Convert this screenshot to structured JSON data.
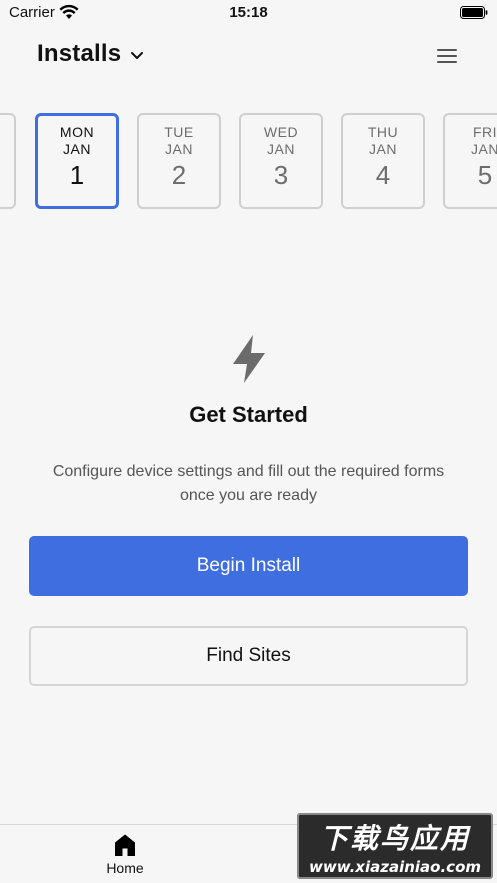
{
  "status_bar": {
    "carrier": "Carrier",
    "time": "15:18"
  },
  "header": {
    "title": "Installs"
  },
  "days": [
    {
      "dow": "",
      "month": "",
      "day": "",
      "selected": false
    },
    {
      "dow": "MON",
      "month": "JAN",
      "day": "1",
      "selected": true
    },
    {
      "dow": "TUE",
      "month": "JAN",
      "day": "2",
      "selected": false
    },
    {
      "dow": "WED",
      "month": "JAN",
      "day": "3",
      "selected": false
    },
    {
      "dow": "THU",
      "month": "JAN",
      "day": "4",
      "selected": false
    },
    {
      "dow": "FRI",
      "month": "JAN",
      "day": "5",
      "selected": false
    }
  ],
  "main": {
    "icon": "lightning-bolt-icon",
    "heading": "Get Started",
    "description": "Configure device settings and fill out the required forms once you are ready",
    "primary_button": "Begin Install",
    "secondary_button": "Find Sites"
  },
  "tabbar": {
    "home_label": "Home"
  },
  "watermark": {
    "top": "下载鸟应用",
    "bottom": "www.xiazainiao.com"
  },
  "colors": {
    "accent": "#3e6ee0",
    "background": "#f6f6f6",
    "border": "#cfcfcf"
  }
}
